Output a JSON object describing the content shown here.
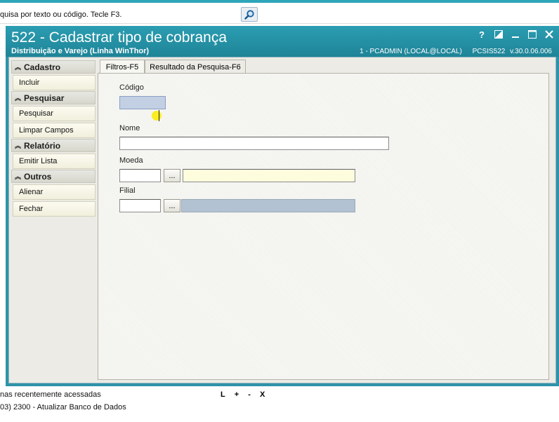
{
  "search": {
    "placeholder_text": "quisa por texto ou código. Tecle F3.",
    "button_icon": "magnifier-icon"
  },
  "window": {
    "title": "522 - Cadastrar tipo de cobrança",
    "subtitle": "Distribuição e Varejo (Linha WinThor)",
    "user": "1 - PCADMIN (LOCAL@LOCAL)",
    "module": "PCSIS522",
    "version": "v.30.0.06.006",
    "controls": {
      "help": "?",
      "restore": "◩",
      "minimize": "–",
      "maximize": "☐",
      "close": "✕"
    }
  },
  "sidebar": {
    "groups": [
      {
        "label": "Cadastro",
        "items": [
          "Incluir"
        ]
      },
      {
        "label": "Pesquisar",
        "items": [
          "Pesquisar",
          "Limpar Campos"
        ]
      },
      {
        "label": "Relatório",
        "items": [
          "Emitir Lista"
        ]
      },
      {
        "label": "Outros",
        "items": [
          "Alienar",
          "Fechar"
        ]
      }
    ]
  },
  "tabs": {
    "filtros": "Filtros-F5",
    "resultado": "Resultado da Pesquisa-F6"
  },
  "form": {
    "codigo_label": "Código",
    "codigo_value": "",
    "nome_label": "Nome",
    "nome_value": "",
    "moeda_label": "Moeda",
    "moeda_code": "",
    "moeda_desc": "",
    "filial_label": "Filial",
    "filial_code": "",
    "filial_desc": "",
    "ellipsis": "..."
  },
  "footer": {
    "recent": "nas recentemente acessadas",
    "controls": [
      "L",
      "+",
      "-",
      "X"
    ],
    "last_item": " 03)  2300 - Atualizar Banco de Dados"
  },
  "colors": {
    "title_bar": "#2b9db2",
    "accent_cyan": "#2ea5b9"
  }
}
